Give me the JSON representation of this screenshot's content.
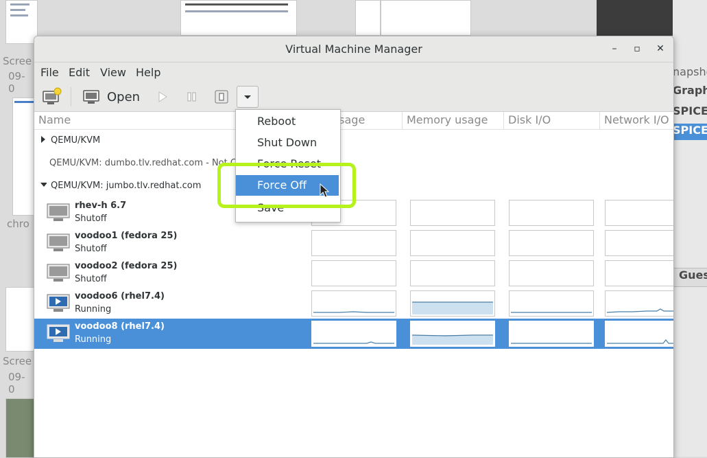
{
  "background": {
    "left_texts": [
      "Scree",
      "09-0",
      "chro",
      "Scree",
      "09-0"
    ],
    "right_texts": [
      "napsho",
      "Graphic",
      "SPICE",
      "SPICE",
      "Gues"
    ]
  },
  "window": {
    "title": "Virtual Machine Manager",
    "minimize": "–",
    "maximize": "▫",
    "close": "✕"
  },
  "menubar": [
    "File",
    "Edit",
    "View",
    "Help"
  ],
  "toolbar": {
    "open_label": "Open"
  },
  "columns": [
    "Name",
    "usage",
    "Memory usage",
    "Disk I/O",
    "Network I/O"
  ],
  "connections": [
    {
      "label": "QEMU/KVM"
    },
    {
      "label": "QEMU/KVM: dumbo.tlv.redhat.com - Not C"
    },
    {
      "label": "QEMU/KVM: jumbo.tlv.redhat.com"
    }
  ],
  "vms": [
    {
      "name": "rhev-h 6.7",
      "state": "Shutoff",
      "icon": "monitor-off-icon"
    },
    {
      "name": "voodoo1 (fedora 25)",
      "state": "Shutoff",
      "icon": "monitor-off-icon"
    },
    {
      "name": "voodoo2 (fedora 25)",
      "state": "Shutoff",
      "icon": "monitor-off-icon"
    },
    {
      "name": "voodoo6 (rhel7.4)",
      "state": "Running",
      "icon": "monitor-running-icon"
    },
    {
      "name": "voodoo8 (rhel7.4)",
      "state": "Running",
      "icon": "monitor-running-icon",
      "selected": true
    }
  ],
  "dropdown": {
    "items": [
      "Reboot",
      "Shut Down",
      "Force Reset",
      "Force Off",
      "Save"
    ],
    "selected": "Force Off"
  },
  "colors": {
    "selection": "#4a90d9",
    "highlight_ring": "#b6f21c"
  }
}
